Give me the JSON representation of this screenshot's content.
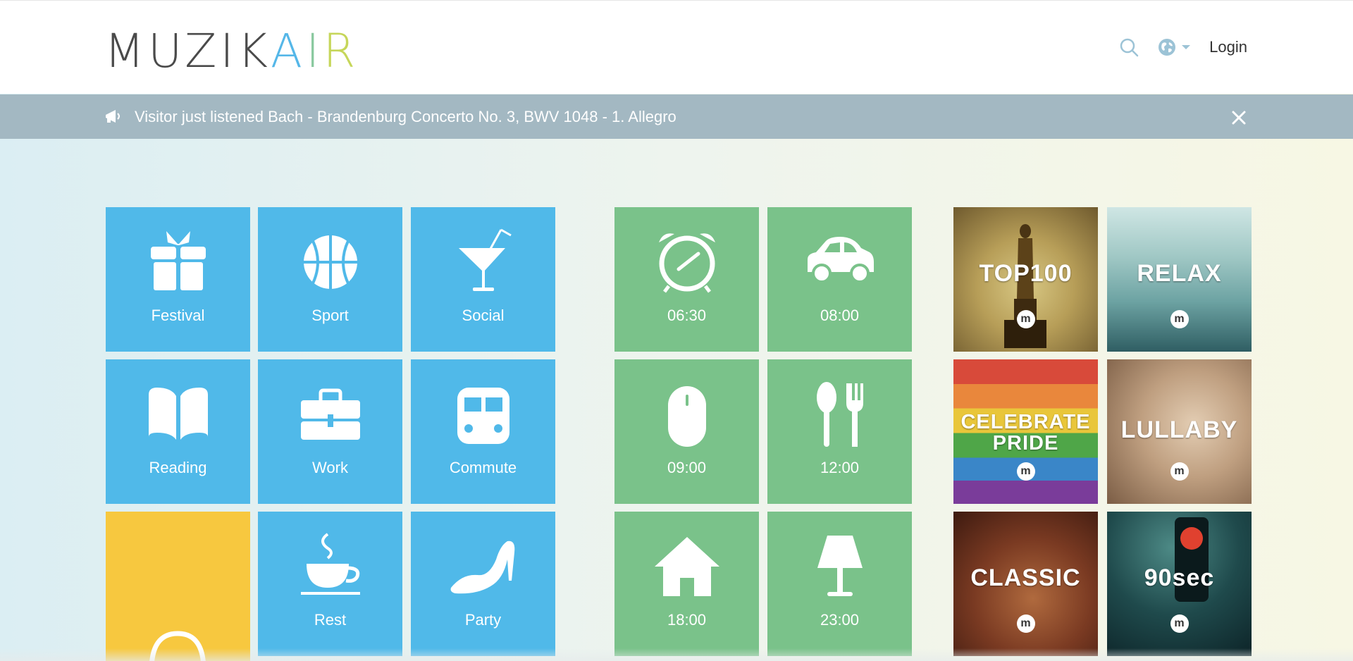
{
  "header": {
    "logo": {
      "part1": "MUZIK",
      "part2": "A",
      "part3": "I",
      "part4": "R"
    },
    "login_label": "Login",
    "icons": [
      "search-icon",
      "globe-icon",
      "chevron-down-icon"
    ]
  },
  "banner": {
    "text": "Visitor just listened Bach - Brandenburg Concerto No. 3, BWV 1048 - 1. Allegro",
    "icons": [
      "megaphone-icon",
      "close-icon"
    ]
  },
  "activities": [
    {
      "label": "Festival",
      "icon": "gift-icon"
    },
    {
      "label": "Sport",
      "icon": "basketball-icon"
    },
    {
      "label": "Social",
      "icon": "cocktail-icon"
    },
    {
      "label": "Reading",
      "icon": "book-icon"
    },
    {
      "label": "Work",
      "icon": "briefcase-icon"
    },
    {
      "label": "Commute",
      "icon": "train-icon"
    },
    {
      "label": "",
      "icon": "headphones-icon"
    },
    {
      "label": "Rest",
      "icon": "coffee-cup-icon"
    },
    {
      "label": "Party",
      "icon": "high-heel-icon"
    }
  ],
  "times": [
    {
      "label": "06:30",
      "icon": "alarm-clock-icon"
    },
    {
      "label": "08:00",
      "icon": "car-icon"
    },
    {
      "label": "09:00",
      "icon": "mouse-icon"
    },
    {
      "label": "12:00",
      "icon": "utensils-icon"
    },
    {
      "label": "18:00",
      "icon": "house-icon"
    },
    {
      "label": "23:00",
      "icon": "lamp-icon"
    }
  ],
  "playlists": [
    {
      "line1": "TOP100",
      "line2": "",
      "badge": "m"
    },
    {
      "line1": "RELAX",
      "line2": "",
      "badge": "m"
    },
    {
      "line1": "CELEBRATE",
      "line2": "PRIDE",
      "badge": "m"
    },
    {
      "line1": "LULLABY",
      "line2": "",
      "badge": "m"
    },
    {
      "line1": "CLASSIC",
      "line2": "",
      "badge": "m"
    },
    {
      "line1": "90sec",
      "line2": "",
      "badge": "m"
    }
  ],
  "colors": {
    "activity_tile": "#50b9e9",
    "time_tile": "#7ac28a",
    "highlight_tile": "#f7c83f",
    "banner": "#a3b8c2"
  }
}
